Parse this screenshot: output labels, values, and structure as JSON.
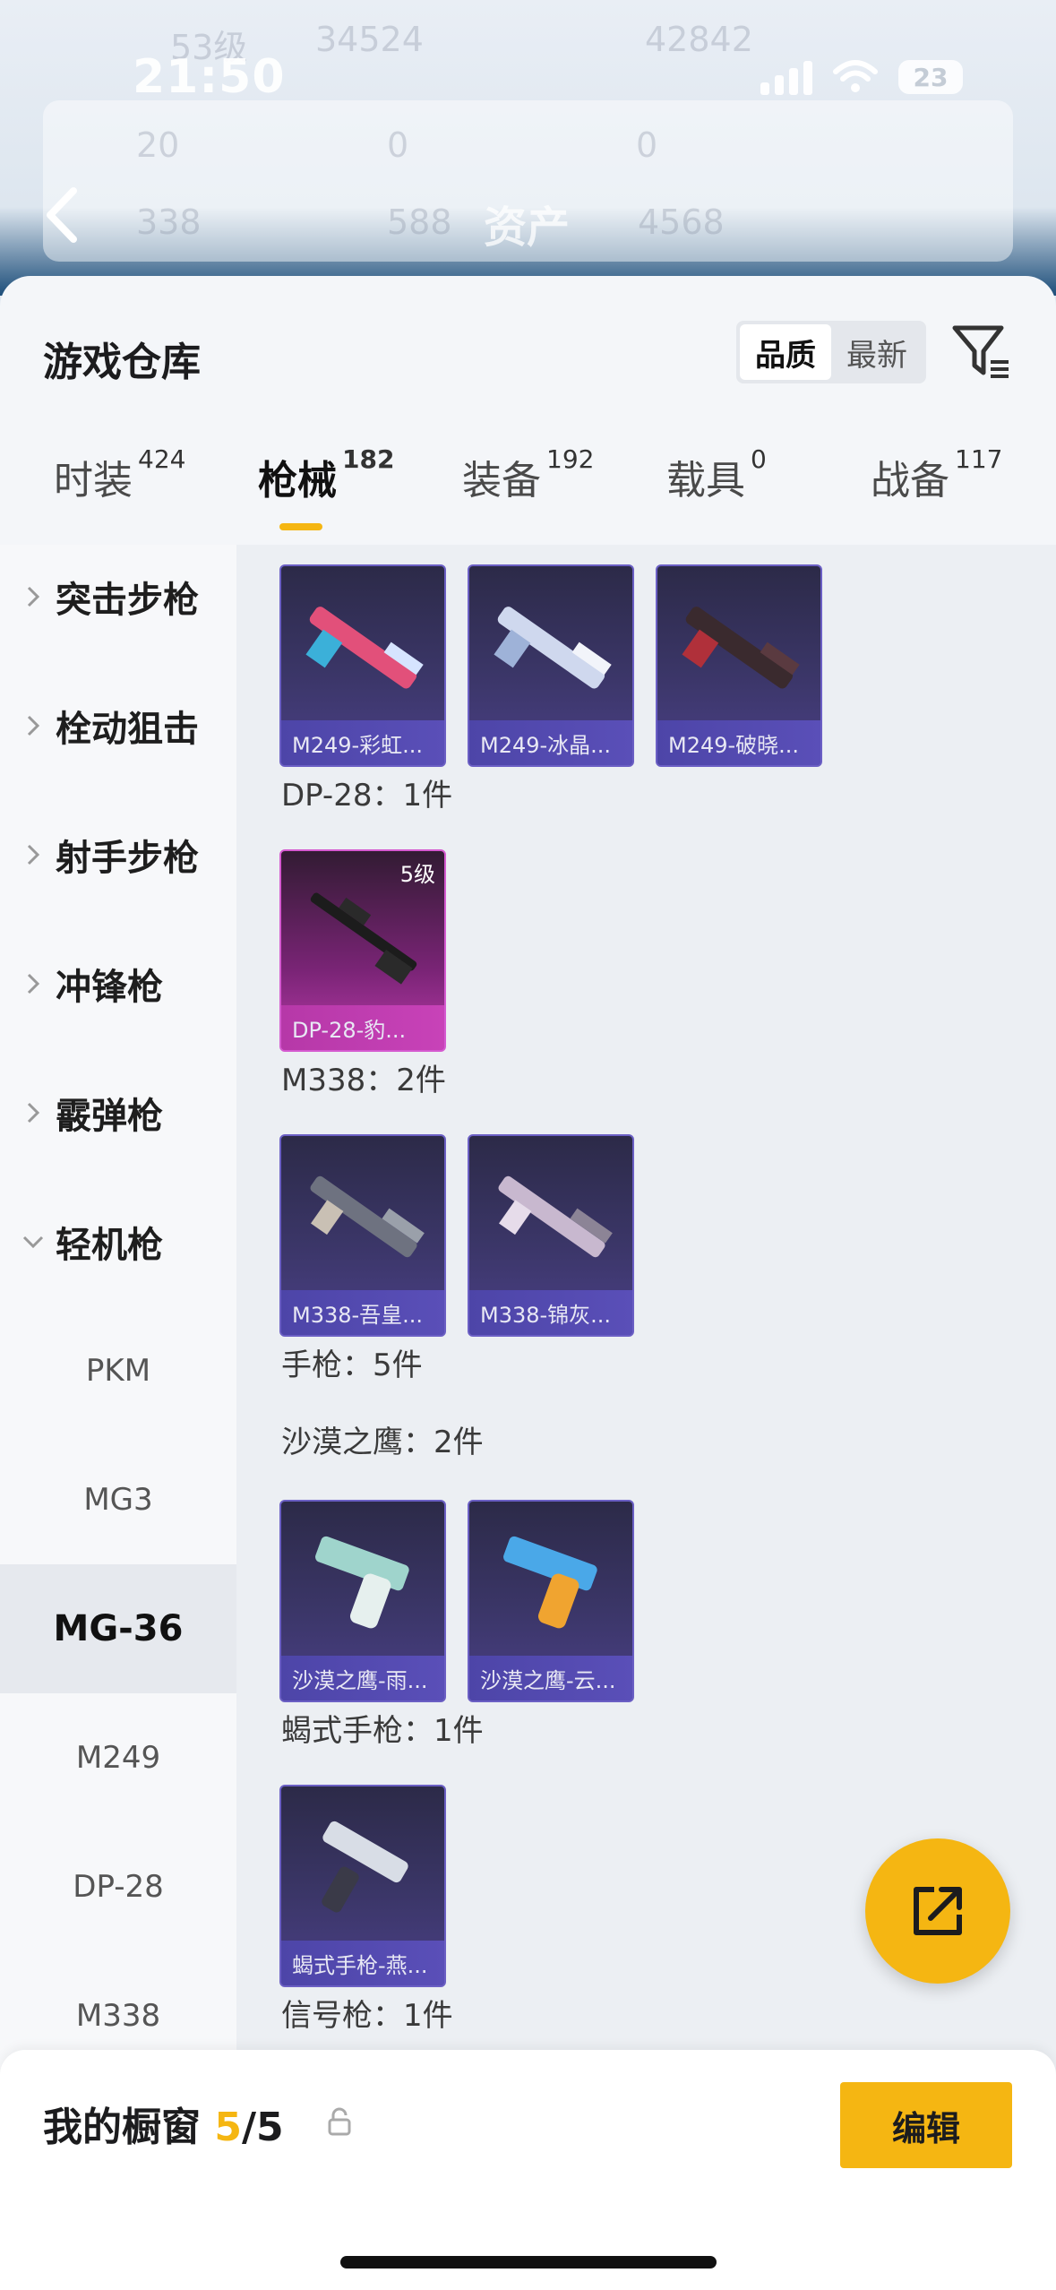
{
  "status_bar": {
    "time": "21:50",
    "battery": "23"
  },
  "header": {
    "title": "资产",
    "ghost_stats": [
      "53级",
      "34524",
      "42842",
      "20",
      "0",
      "0",
      "338",
      "588",
      "4568"
    ]
  },
  "warehouse": {
    "title": "游戏仓库",
    "sort_options": [
      "品质",
      "最新"
    ],
    "active_sort": "品质"
  },
  "tabs": [
    {
      "label": "时装",
      "count": "424"
    },
    {
      "label": "枪械",
      "count": "182",
      "active": true
    },
    {
      "label": "装备",
      "count": "192"
    },
    {
      "label": "载具",
      "count": "0"
    },
    {
      "label": "战备",
      "count": "117"
    }
  ],
  "sidebar": {
    "categories": [
      "突击步枪",
      "栓动狙击",
      "射手步枪",
      "冲锋枪",
      "霰弹枪",
      "轻机枪"
    ],
    "expanded_category": "轻机枪",
    "subcategories": [
      "PKM",
      "MG3",
      "MG-36",
      "M249",
      "DP-28",
      "M338"
    ],
    "selected_subcategory": "MG-36"
  },
  "content": {
    "groups": [
      {
        "label": "",
        "items": [
          {
            "name": "M249-彩虹...",
            "accent": "#e2507a"
          },
          {
            "name": "M249-冰晶...",
            "accent": "#cfd8ee"
          },
          {
            "name": "M249-破晓...",
            "accent": "#b0303a"
          }
        ]
      },
      {
        "label": "DP-28：1件",
        "items": [
          {
            "name": "DP-28-豹...",
            "level": "5级",
            "accent": "#2a2a2a",
            "rarity": "pink"
          }
        ]
      },
      {
        "label": "M338：2件",
        "items": [
          {
            "name": "M338-吾皇...",
            "accent": "#9aa0aa"
          },
          {
            "name": "M338-锦灰...",
            "accent": "#c8b8cf"
          }
        ]
      },
      {
        "label": "手枪：5件",
        "items": []
      },
      {
        "label": "沙漠之鹰：2件",
        "items": [
          {
            "name": "沙漠之鹰-雨...",
            "accent": "#9fd4cc"
          },
          {
            "name": "沙漠之鹰-云...",
            "accent": "#f0a430"
          }
        ]
      },
      {
        "label": "蝎式手枪：1件",
        "items": [
          {
            "name": "蝎式手枪-燕...",
            "accent": "#d8dde6"
          }
        ]
      },
      {
        "label": "信号枪：1件",
        "items": []
      }
    ]
  },
  "bottom_bar": {
    "label": "我的橱窗",
    "count_current": "5",
    "count_total": "/5",
    "edit_label": "编辑"
  },
  "colors": {
    "accent": "#f5b612",
    "item_bg": "#3b3668",
    "item_border": "#6b5fc4",
    "rare_pink": "#b83aa8"
  }
}
